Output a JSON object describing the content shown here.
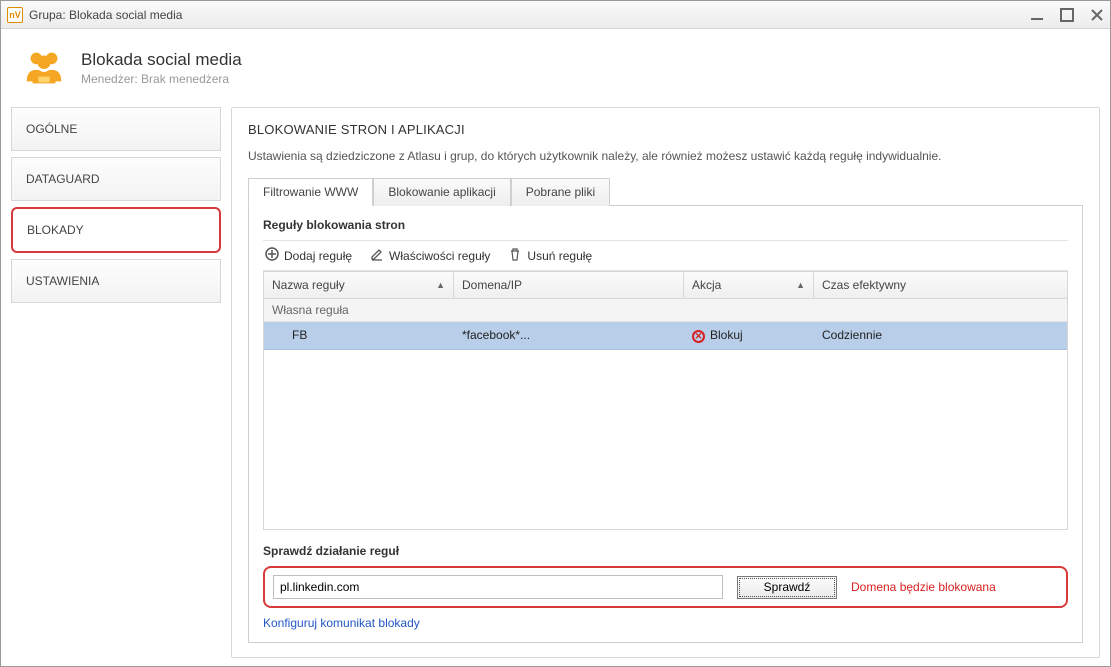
{
  "window": {
    "title": "Grupa: Blokada social media"
  },
  "header": {
    "title": "Blokada social media",
    "manager_label": "Menedżer:",
    "manager_value": "Brak menedżera"
  },
  "sidebar": {
    "items": [
      {
        "label": "OGÓLNE"
      },
      {
        "label": "DATAGUARD"
      },
      {
        "label": "BLOKADY"
      },
      {
        "label": "USTAWIENIA"
      }
    ]
  },
  "main": {
    "title": "BLOKOWANIE STRON I APLIKACJI",
    "subtitle": "Ustawienia są dziedziczone z Atlasu i grup, do których użytkownik należy, ale również możesz ustawić każdą regułę indywidualnie.",
    "tabs": [
      {
        "label": "Filtrowanie WWW"
      },
      {
        "label": "Blokowanie aplikacji"
      },
      {
        "label": "Pobrane pliki"
      }
    ],
    "rules": {
      "section_title": "Reguły blokowania stron",
      "toolbar": {
        "add": "Dodaj regułę",
        "props": "Właściwości reguły",
        "delete": "Usuń regułę"
      },
      "columns": {
        "name": "Nazwa reguły",
        "domain": "Domena/IP",
        "action": "Akcja",
        "time": "Czas efektywny"
      },
      "group_label": "Własna reguła",
      "rows": [
        {
          "name": "FB",
          "domain": "*facebook*...",
          "action": "Blokuj",
          "time": "Codziennie"
        }
      ]
    },
    "check": {
      "section_title": "Sprawdź działanie reguł",
      "input_value": "pl.linkedin.com",
      "button": "Sprawdź",
      "result": "Domena będzie blokowana",
      "config_link": "Konfiguruj komunikat blokady"
    }
  }
}
